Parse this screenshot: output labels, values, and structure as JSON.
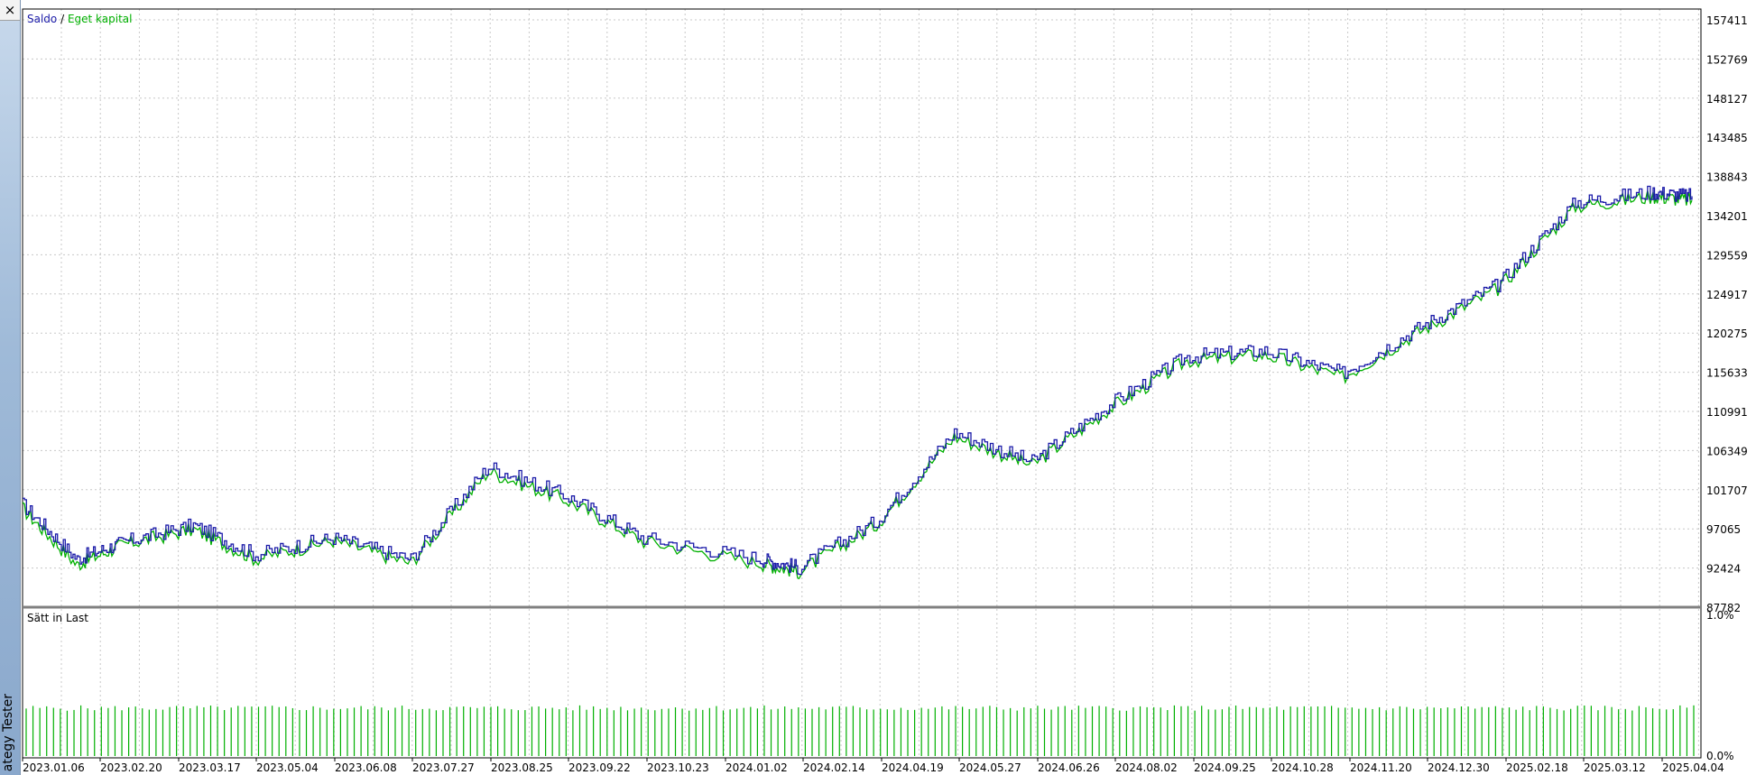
{
  "panel": {
    "close_glyph": "×",
    "title": "ategy Tester"
  },
  "colors": {
    "balance": "#1a1aa8",
    "equity": "#00b000",
    "grid": "#c8c8c8",
    "frame": "#000000",
    "separator": "#808080"
  },
  "chart_data": [
    {
      "type": "line",
      "legend": [
        "Saldo",
        "Eget kapital"
      ],
      "legend_separator": " / ",
      "y_ticks": [
        "157411",
        "152769",
        "148127",
        "143485",
        "138843",
        "134201",
        "129559",
        "124917",
        "120275",
        "115633",
        "110991",
        "106349",
        "101707",
        "97065",
        "92424",
        "87782"
      ],
      "ylim": [
        87782,
        159500
      ],
      "x_ticks": [
        "2023.01.06",
        "2023.02.20",
        "2023.03.17",
        "2023.05.04",
        "2023.06.08",
        "2023.07.27",
        "2023.08.25",
        "2023.09.22",
        "2023.10.23",
        "2024.01.02",
        "2024.02.14",
        "2024.04.19",
        "2024.05.27",
        "2024.06.26",
        "2024.08.02",
        "2024.09.25",
        "2024.10.28",
        "2024.11.20",
        "2024.12.30",
        "2025.02.18",
        "2025.03.12",
        "2025.04.04"
      ],
      "series": [
        {
          "name": "Saldo",
          "x": [
            0,
            0.7,
            1.3,
            2.2,
            3,
            4,
            5,
            6,
            7,
            8,
            9.5,
            10,
            11,
            12,
            13,
            14,
            15,
            16,
            17,
            18,
            19,
            20,
            21,
            21.5
          ],
          "values": [
            100000,
            93500,
            95500,
            97500,
            94000,
            96000,
            93500,
            104500,
            101000,
            96000,
            93500,
            92500,
            98000,
            108500,
            105000,
            111800,
            117500,
            118200,
            115500,
            121000,
            126000,
            135800,
            137000,
            136500
          ]
        },
        {
          "name": "Eget kapital",
          "x": [
            0,
            0.7,
            1.3,
            2.2,
            3,
            4,
            5,
            6,
            7,
            8,
            9.5,
            10,
            11,
            12,
            13,
            14,
            15,
            16,
            17,
            18,
            19,
            20,
            21,
            21.5
          ],
          "values": [
            99500,
            92800,
            95200,
            97000,
            93500,
            95700,
            93000,
            103900,
            100500,
            95600,
            93000,
            92000,
            97600,
            108000,
            104600,
            111300,
            117000,
            117700,
            115000,
            120500,
            125500,
            135300,
            136500,
            136000
          ]
        }
      ]
    },
    {
      "type": "bar",
      "title": "Sätt in Last",
      "y_ticks": [
        "1.0%",
        "0.0%"
      ],
      "ylim": [
        0,
        1.0
      ],
      "bar_count": 245,
      "bar_value_range": [
        0.33,
        0.37
      ]
    }
  ]
}
